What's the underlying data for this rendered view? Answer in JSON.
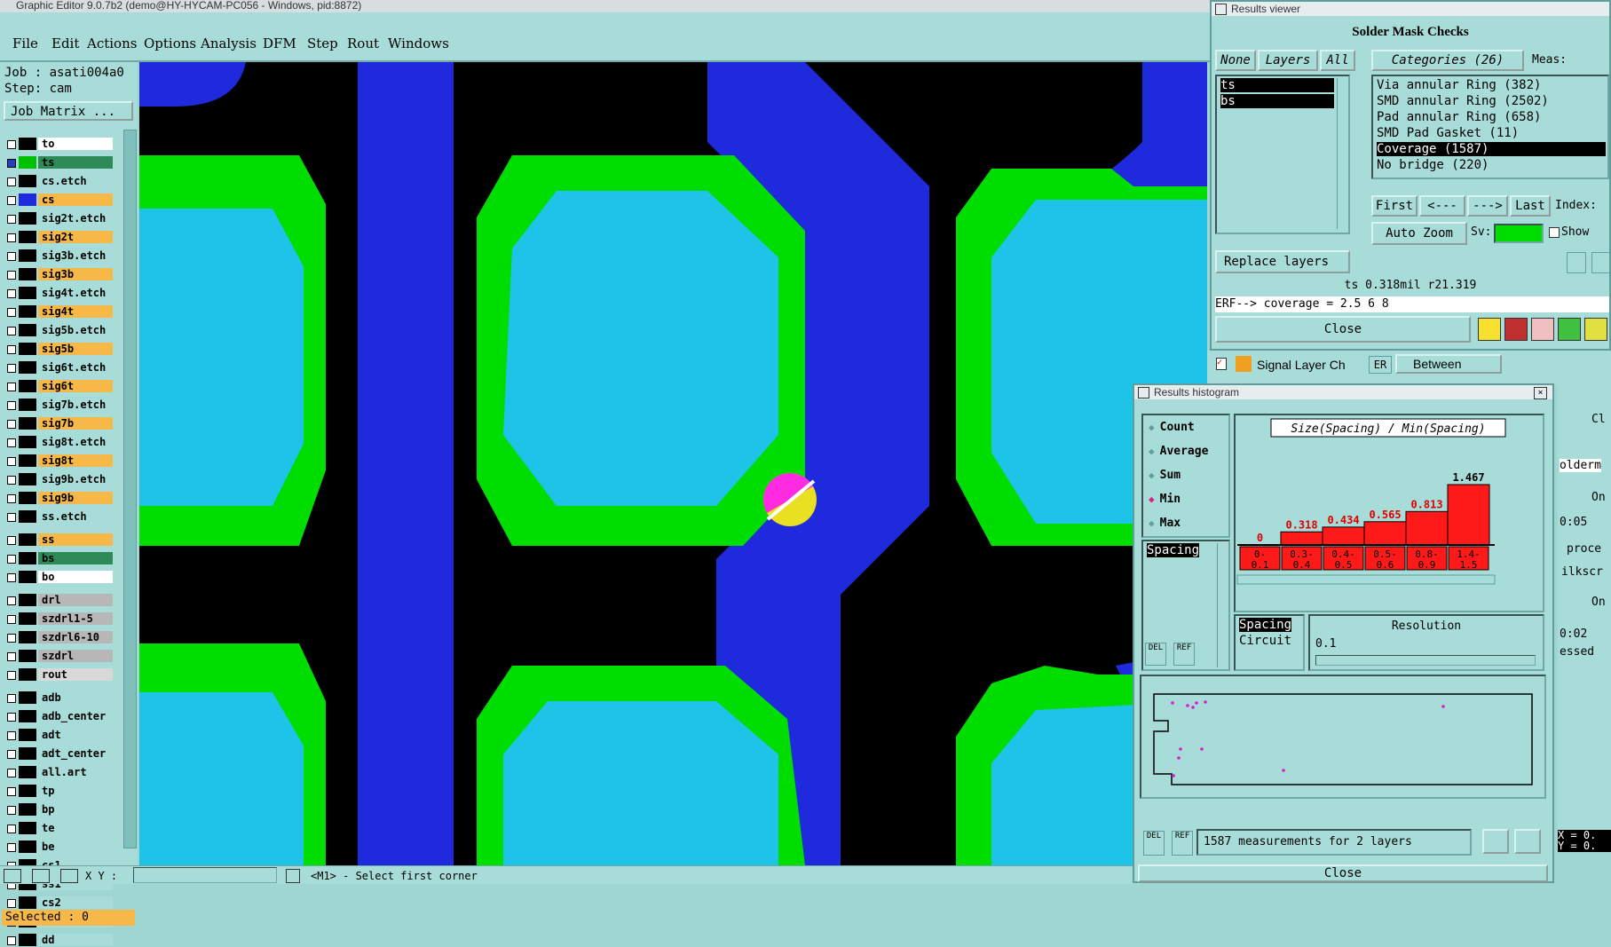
{
  "window": {
    "title": "Graphic Editor 9.0.7b2 (demo@HY-HYCAM-PC056 - Windows, pid:8872)"
  },
  "menu": [
    {
      "label": "File"
    },
    {
      "label": "Edit"
    },
    {
      "label": "Actions"
    },
    {
      "label": "Options"
    },
    {
      "label": "Analysis"
    },
    {
      "label": "DFM"
    },
    {
      "label": "Step"
    },
    {
      "label": "Rout"
    },
    {
      "label": "Windows"
    }
  ],
  "left_panel": {
    "job": "Job : asati004a0",
    "step": "Step: cam",
    "job_matrix_label": "Job Matrix ...",
    "selected": "Selected : 0",
    "layers": [
      {
        "name": "to",
        "swatch": "#000000",
        "bg": "#ffffff"
      },
      {
        "name": "ts",
        "swatch": "#00c000",
        "bg": "#2e8b57",
        "checked": true
      },
      {
        "name": "cs.etch",
        "swatch": "#000000",
        "bg": "#a7dcd8"
      },
      {
        "name": "cs",
        "swatch": "#1e2adc",
        "bg": "#f7b84a"
      },
      {
        "name": "sig2t.etch",
        "swatch": "#000000",
        "bg": "#a7dcd8"
      },
      {
        "name": "sig2t",
        "swatch": "#000000",
        "bg": "#f7b84a"
      },
      {
        "name": "sig3b.etch",
        "swatch": "#000000",
        "bg": "#a7dcd8"
      },
      {
        "name": "sig3b",
        "swatch": "#000000",
        "bg": "#f7b84a"
      },
      {
        "name": "sig4t.etch",
        "swatch": "#000000",
        "bg": "#a7dcd8"
      },
      {
        "name": "sig4t",
        "swatch": "#000000",
        "bg": "#f7b84a"
      },
      {
        "name": "sig5b.etch",
        "swatch": "#000000",
        "bg": "#a7dcd8"
      },
      {
        "name": "sig5b",
        "swatch": "#000000",
        "bg": "#f7b84a"
      },
      {
        "name": "sig6t.etch",
        "swatch": "#000000",
        "bg": "#a7dcd8"
      },
      {
        "name": "sig6t",
        "swatch": "#000000",
        "bg": "#f7b84a"
      },
      {
        "name": "sig7b.etch",
        "swatch": "#000000",
        "bg": "#a7dcd8"
      },
      {
        "name": "sig7b",
        "swatch": "#000000",
        "bg": "#f7b84a"
      },
      {
        "name": "sig8t.etch",
        "swatch": "#000000",
        "bg": "#a7dcd8"
      },
      {
        "name": "sig8t",
        "swatch": "#000000",
        "bg": "#f7b84a"
      },
      {
        "name": "sig9b.etch",
        "swatch": "#000000",
        "bg": "#a7dcd8"
      },
      {
        "name": "sig9b",
        "swatch": "#000000",
        "bg": "#f7b84a"
      },
      {
        "name": "ss.etch",
        "swatch": "#000000",
        "bg": "#a7dcd8"
      },
      {
        "name": "ss",
        "swatch": "#000000",
        "bg": "#f7b84a"
      },
      {
        "name": "bs",
        "swatch": "#000000",
        "bg": "#2e8b57"
      },
      {
        "name": "bo",
        "swatch": "#000000",
        "bg": "#ffffff"
      },
      {
        "name": "drl",
        "swatch": "#000000",
        "bg": "#b7b7b7"
      },
      {
        "name": "szdrl1-5",
        "swatch": "#000000",
        "bg": "#b7b7b7"
      },
      {
        "name": "szdrl6-10",
        "swatch": "#000000",
        "bg": "#b7b7b7"
      },
      {
        "name": "szdrl",
        "swatch": "#000000",
        "bg": "#b7b7b7"
      },
      {
        "name": "rout",
        "swatch": "#000000",
        "bg": "#d9d9d9"
      },
      {
        "name": "adb",
        "swatch": "#000000",
        "bg": "#a7dcd8"
      },
      {
        "name": "adb_center",
        "swatch": "#000000",
        "bg": "#a7dcd8"
      },
      {
        "name": "adt",
        "swatch": "#000000",
        "bg": "#a7dcd8"
      },
      {
        "name": "adt_center",
        "swatch": "#000000",
        "bg": "#a7dcd8"
      },
      {
        "name": "all.art",
        "swatch": "#000000",
        "bg": "#a7dcd8"
      },
      {
        "name": "tp",
        "swatch": "#000000",
        "bg": "#a7dcd8"
      },
      {
        "name": "bp",
        "swatch": "#000000",
        "bg": "#a7dcd8"
      },
      {
        "name": "te",
        "swatch": "#000000",
        "bg": "#a7dcd8"
      },
      {
        "name": "be",
        "swatch": "#000000",
        "bg": "#a7dcd8"
      },
      {
        "name": "cs1",
        "swatch": "#000000",
        "bg": "#a7dcd8"
      },
      {
        "name": "ss1",
        "swatch": "#000000",
        "bg": "#a7dcd8"
      },
      {
        "name": "cs2",
        "swatch": "#000000",
        "bg": "#a7dcd8"
      },
      {
        "name": "ss2",
        "swatch": "#000000",
        "bg": "#a7dcd8"
      },
      {
        "name": "dd",
        "swatch": "#000000",
        "bg": "#a7dcd8"
      }
    ]
  },
  "bottom_bar": {
    "xy_label": "X Y :",
    "status": "<M1> - Select first corner"
  },
  "results_viewer": {
    "title": "Results viewer",
    "heading": "Solder Mask Checks",
    "tabs": {
      "none": "None",
      "layers": "Layers",
      "all": "All"
    },
    "layers": [
      "ts",
      "bs"
    ],
    "categories_header": "Categories (26)",
    "meas_label": "Meas:",
    "categories": [
      {
        "label": "Via annular Ring (382)",
        "selected": false
      },
      {
        "label": "SMD annular Ring (2502)",
        "selected": false
      },
      {
        "label": "Pad annular Ring (658)",
        "selected": false
      },
      {
        "label": "SMD Pad Gasket (11)",
        "selected": false
      },
      {
        "label": "Coverage (1587)",
        "selected": true
      },
      {
        "label": "No bridge (220)",
        "selected": false
      }
    ],
    "nav": {
      "first": "First",
      "prev": "<---",
      "next": "--->",
      "last": "Last",
      "index_label": "Index:"
    },
    "auto_zoom": "Auto Zoom",
    "sv_label": "Sv:",
    "show_label": "Show",
    "replace_layers": "Replace layers",
    "measure_info": "ts 0.318mil  r21.319",
    "erf_line": "ERF--> coverage = 2.5 6 8",
    "close": "Close"
  },
  "signal_layer": {
    "label": "Signal Layer Ch",
    "er": "ER",
    "between": "Between"
  },
  "histogram": {
    "title": "Results histogram",
    "options": [
      {
        "label": "Count",
        "selected": false
      },
      {
        "label": "Average",
        "selected": false
      },
      {
        "label": "Sum",
        "selected": false
      },
      {
        "label": "Min",
        "selected": true
      },
      {
        "label": "Max",
        "selected": false
      }
    ],
    "list_item": "Spacing",
    "bottom_list": [
      "Spacing",
      "Circuit"
    ],
    "resolution_label": "Resolution",
    "resolution_value": "0.1",
    "summary": "1587 measurements for 2 layers",
    "close": "Close",
    "del": "DEL",
    "ref": "REF"
  },
  "right_fragments": {
    "cl": "Cl",
    "olderm": "olderm",
    "on1": "On",
    "t05": "0:05",
    "proce": "proce",
    "ilkscr": "ilkscr",
    "on2": "On",
    "t02": "0:02",
    "essed": "essed",
    "x": "X = 0.",
    "y": "Y = 0."
  },
  "chart_data": {
    "type": "bar",
    "title": "Size(Spacing) / Min(Spacing)",
    "categories": [
      "0-0.1",
      "0.3-0.4",
      "0.4-0.5",
      "0.5-0.6",
      "0.8-0.9",
      "1.4-1.5"
    ],
    "values": [
      0,
      0.318,
      0.434,
      0.565,
      0.813,
      1.467
    ],
    "value_labels": [
      "0",
      "0.318",
      "0.434",
      "0.565",
      "0.813",
      "1.467"
    ],
    "category_lines": [
      [
        "0-",
        "0.1"
      ],
      [
        "0.3-",
        "0.4"
      ],
      [
        "0.4-",
        "0.5"
      ],
      [
        "0.5-",
        "0.6"
      ],
      [
        "0.8-",
        "0.9"
      ],
      [
        "1.4-",
        "1.5"
      ]
    ],
    "bar_color": "#ff1a1a",
    "label_color": "#e00000"
  },
  "colors": {
    "ts": "#00dd00",
    "pad": "#1ec3e8",
    "cs": "#1e2adc",
    "bg": "#000000",
    "marker_top": "#ff2be0",
    "marker_bottom": "#e8e020"
  }
}
